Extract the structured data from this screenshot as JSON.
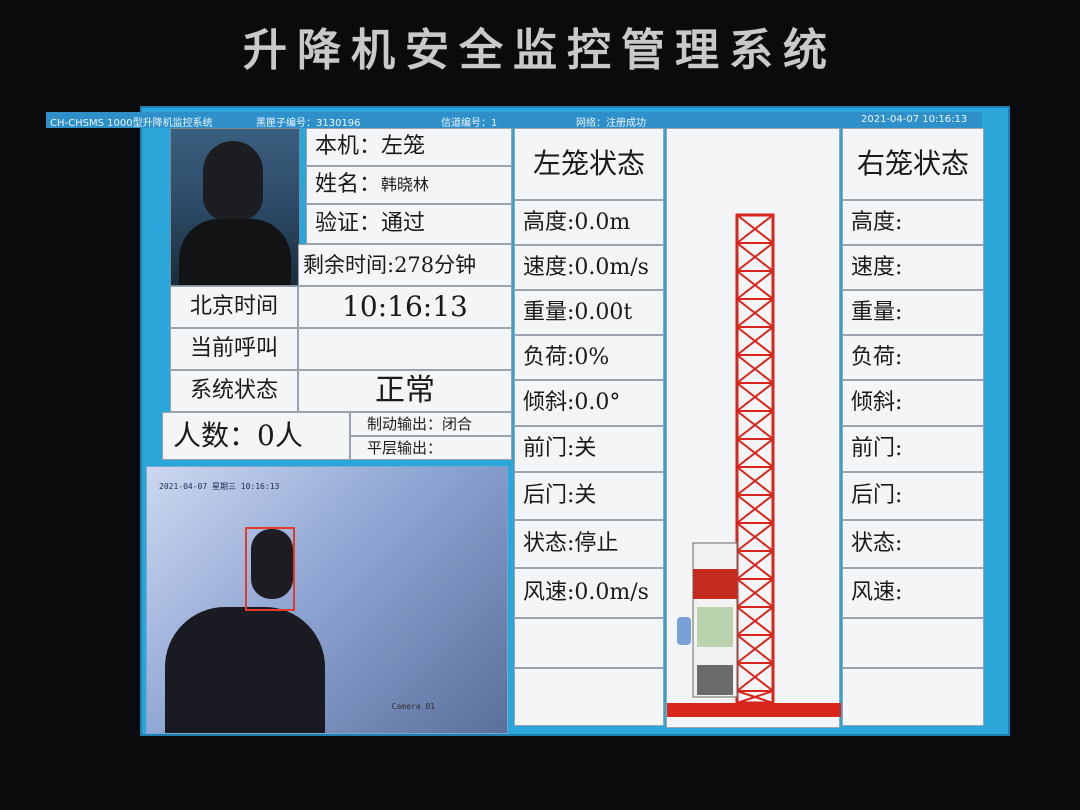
{
  "header": {
    "title": "升降机安全监控管理系统"
  },
  "statusbar": {
    "system": "CH-CHSMS 1000型升降机监控系统",
    "blackbox": "黑匣子编号：3130196",
    "channel": "信道编号：1",
    "network": "网络：注册成功",
    "datetime": "2021-04-07  10:16:13"
  },
  "operator": {
    "machine_label": "本机：左笼",
    "name_label": "姓名：",
    "name_value": "韩晓林",
    "verify_label": "验证：通过",
    "remaining": "剩余时间:278分钟"
  },
  "info": {
    "beijing_time_label": "北京时间",
    "beijing_time_value": "10:16:13",
    "current_call_label": "当前呼叫",
    "current_call_value": "",
    "system_status_label": "系统状态",
    "system_status_value": "正常",
    "people_count": "人数：0人",
    "brake_output": "制动输出：闭合",
    "level_output": "平层输出："
  },
  "camera": {
    "overlay_top": "2021-04-07 星期三 10:16:13",
    "overlay_bottom": "Camera 01"
  },
  "left_cage": {
    "title": "左笼状态",
    "rows": [
      "高度:0.0m",
      "速度:0.0m/s",
      "重量:0.00t",
      "负荷:0%",
      "倾斜:0.0°",
      "前门:关",
      "后门:关",
      "状态:停止",
      "风速:0.0m/s",
      "",
      ""
    ]
  },
  "right_cage": {
    "title": "右笼状态",
    "rows": [
      "高度:",
      "速度:",
      "重量:",
      "负荷:",
      "倾斜:",
      "前门:",
      "后门:",
      "状态:",
      "风速:",
      "",
      ""
    ]
  },
  "colors": {
    "screen_border": "#2aa6d8",
    "mast": "#d9261c",
    "cage": "#c42a1e",
    "status_bar": "#2f8fc8"
  }
}
